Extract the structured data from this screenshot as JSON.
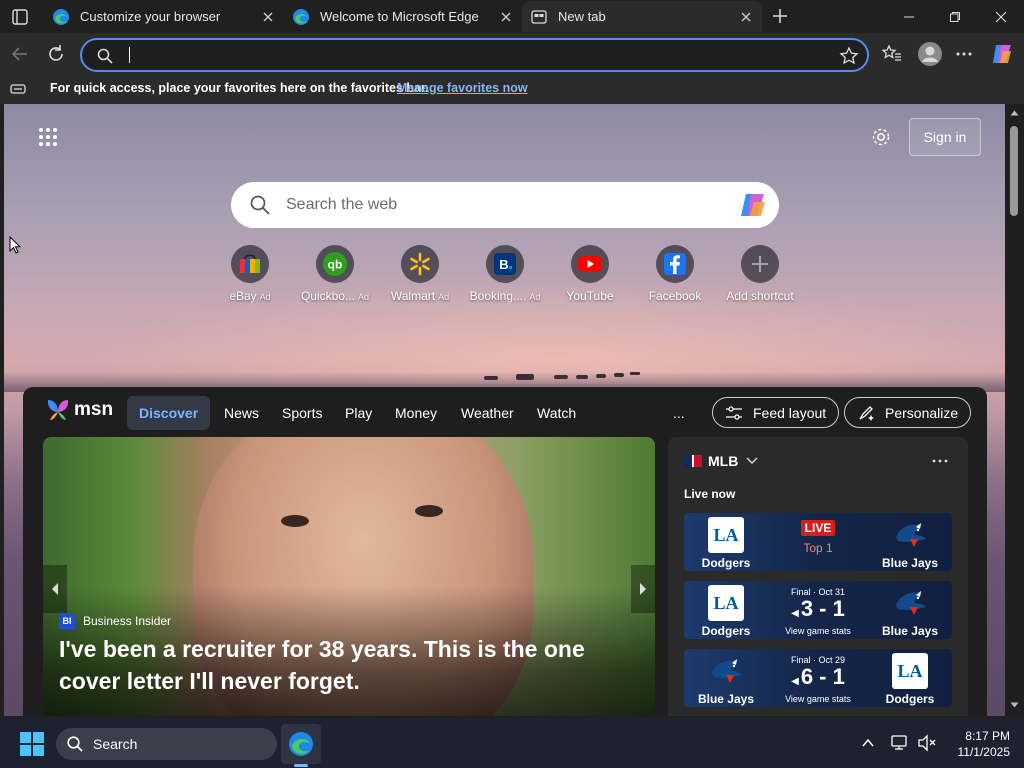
{
  "tabs": [
    {
      "title": "Customize your browser"
    },
    {
      "title": "Welcome to Microsoft Edge"
    },
    {
      "title": "New tab"
    }
  ],
  "address_bar": {
    "value": "",
    "placeholder": ""
  },
  "favorites_bar": {
    "message": "For quick access, place your favorites here on the favorites bar.",
    "link": "Manage favorites now"
  },
  "ntp": {
    "sign_in": "Sign in",
    "search_placeholder": "Search the web",
    "shortcuts": [
      {
        "label": "eBay",
        "ad": "Ad",
        "icon": "ebay-icon"
      },
      {
        "label": "Quickbo...",
        "ad": "Ad",
        "icon": "quickbooks-icon"
      },
      {
        "label": "Walmart",
        "ad": "Ad",
        "icon": "walmart-icon"
      },
      {
        "label": "Booking....",
        "ad": "Ad",
        "icon": "booking-icon"
      },
      {
        "label": "YouTube",
        "ad": "",
        "icon": "youtube-icon"
      },
      {
        "label": "Facebook",
        "ad": "",
        "icon": "facebook-icon"
      },
      {
        "label": "Add shortcut",
        "ad": "",
        "icon": "plus-icon"
      }
    ]
  },
  "feed": {
    "brand": "msn",
    "tabs": [
      "Discover",
      "News",
      "Sports",
      "Play",
      "Money",
      "Weather",
      "Watch"
    ],
    "more": "...",
    "feed_layout": "Feed layout",
    "personalize": "Personalize",
    "hero": {
      "source_badge": "BI",
      "source": "Business Insider",
      "headline": "I've been a recruiter for 38 years. This is the one cover letter I'll never forget."
    }
  },
  "mlb": {
    "title": "MLB",
    "live_now": "Live now",
    "games": [
      {
        "home": "Dodgers",
        "home_logo": "LA",
        "away": "Blue Jays",
        "status": "LIVE",
        "detail": "Top 1",
        "score": "",
        "stats": ""
      },
      {
        "home": "Dodgers",
        "home_logo": "LA",
        "away": "Blue Jays",
        "status": "Final · Oct 31",
        "detail": "",
        "score": "3 - 1",
        "stats": "View game stats"
      },
      {
        "home": "Blue Jays",
        "home_logo": "",
        "away": "Dodgers",
        "away_logo": "LA",
        "status": "Final · Oct 29",
        "detail": "",
        "score": "6 - 1",
        "stats": "View game stats"
      }
    ]
  },
  "taskbar": {
    "search_label": "Search",
    "time": "8:17 PM",
    "date": "11/1/2025"
  },
  "colors": {
    "accent": "#4f8ef7",
    "link": "#8ab4f8",
    "live_red": "#d11f1f",
    "feed_active": "#7db3ff"
  }
}
